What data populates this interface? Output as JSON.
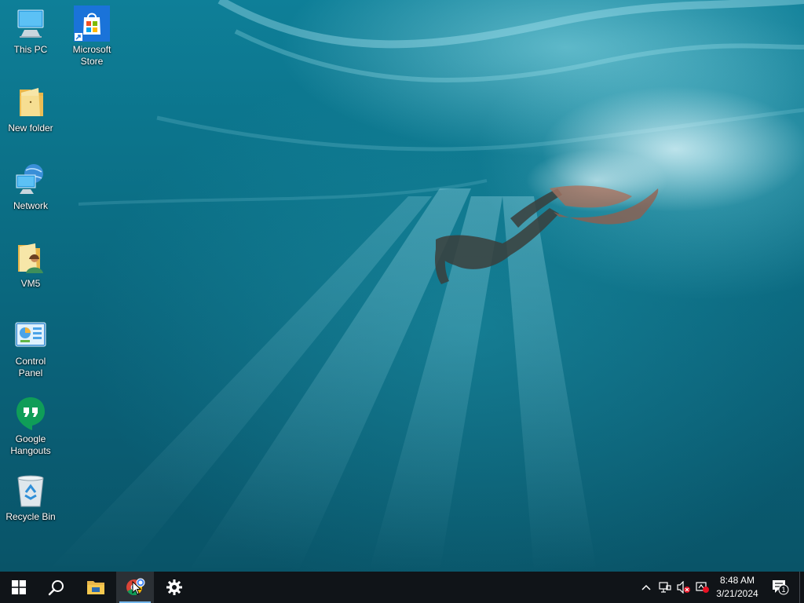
{
  "desktop": {
    "icons": [
      {
        "label": "This PC"
      },
      {
        "label": "Microsoft Store"
      },
      {
        "label": "New folder"
      },
      {
        "label": "Network"
      },
      {
        "label": "VM5"
      },
      {
        "label": "Control Panel"
      },
      {
        "label": "Google Hangouts"
      },
      {
        "label": "Recycle Bin"
      }
    ]
  },
  "taskbar": {
    "start_icon": "windows-logo",
    "search_icon": "search-icon",
    "pinned": [
      {
        "name": "File Explorer",
        "icon": "folder-icon"
      },
      {
        "name": "Google Chrome",
        "icon": "chrome-icon",
        "active": true
      },
      {
        "name": "Settings",
        "icon": "gear-icon"
      }
    ],
    "tray": {
      "time": "8:48 AM",
      "date": "3/21/2024",
      "notification_count": "1"
    }
  },
  "colors": {
    "taskbar_bg": "#101418",
    "active_underline": "#76b9ed",
    "water": "#0b6f86"
  }
}
